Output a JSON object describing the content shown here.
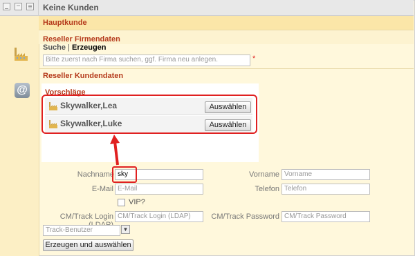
{
  "header": {
    "title": "Keine Kunden"
  },
  "sections": {
    "hauptkunde": "Hauptkunde",
    "reseller_firmendaten": "Reseller Firmendaten",
    "reseller_kundendaten": "Reseller Kundendaten"
  },
  "firma": {
    "suche_label": "Suche",
    "separator": " | ",
    "erzeugen_label": "Erzeugen",
    "search_placeholder": "Bitte zuerst nach Firma suchen, ggf. Firma neu anlegen.",
    "required_marker": "*"
  },
  "suggestions": {
    "title": "Vorschläge",
    "items": [
      {
        "name": "Skywalker,Lea",
        "button": "Auswählen"
      },
      {
        "name": "Skywalker,Luke",
        "button": "Auswählen"
      }
    ]
  },
  "form": {
    "nachname_label": "Nachname",
    "nachname_value": "sky",
    "vorname_label": "Vorname",
    "vorname_placeholder": "Vorname",
    "email_label": "E-Mail",
    "email_placeholder": "E-Mail",
    "telefon_label": "Telefon",
    "telefon_placeholder": "Telefon",
    "vip_label": "VIP?",
    "login_label": "CM/Track Login (LDAP)",
    "login_placeholder": "CM/Track Login (LDAP)",
    "password_label": "CM/Track Password",
    "password_placeholder": "CM/Track Password",
    "role_select": "Track-Benutzer",
    "submit_label": "Erzeugen und auswählen"
  },
  "icons": {
    "window_buttons": [
      "minimize-icon",
      "restore-icon",
      "list-icon"
    ],
    "firma": "factory-icon",
    "kunde": "at-sign-icon",
    "suggestion": "factory-icon",
    "annotation": "red-arrow-icon"
  },
  "colors": {
    "accent_red": "#b53a1b",
    "highlight_red": "#e02020",
    "panel": "#fff8dc"
  }
}
